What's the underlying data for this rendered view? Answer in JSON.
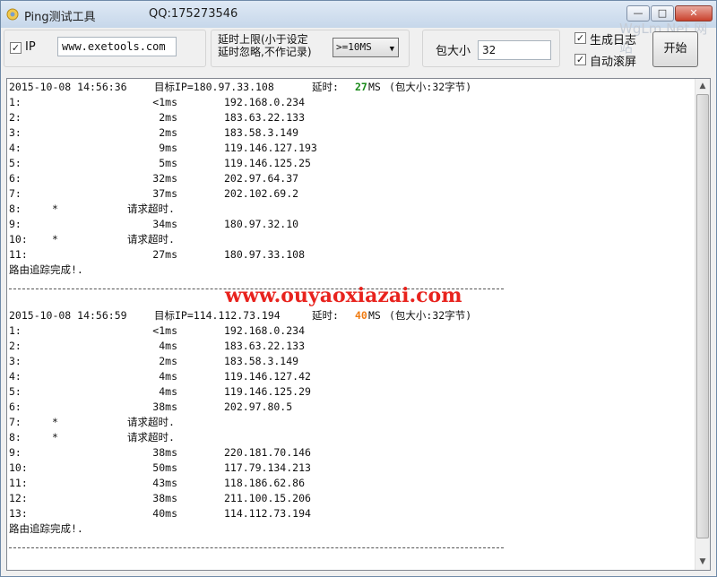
{
  "window": {
    "title": "Ping测试工具",
    "qq": "QQ:175273546",
    "watermark": "WgLm.Net 网站",
    "controls": {
      "minimize": "—",
      "maximize": "□",
      "close": "✕"
    },
    "icon": "ping-app-icon"
  },
  "toolbar": {
    "ip_checked": true,
    "ip_label": "IP",
    "host_value": "www.exetools.com",
    "delay_label_line1": "延时上限(小于设定",
    "delay_label_line2": "延时忽略,不作记录)",
    "delay_select": ">=10MS",
    "packet_label": "包大小",
    "packet_value": "32",
    "log_checked": true,
    "log_label": "生成日志",
    "scroll_checked": true,
    "scroll_label": "自动滚屏",
    "start_label": "开始"
  },
  "output": {
    "site_watermark": "www.ouyaoxiazai.com",
    "sessions": [
      {
        "header": {
          "datetime": "2015-10-08 14:56:36",
          "target": "目标IP=180.97.33.108",
          "delay_label": "延时:",
          "delay_value": "27",
          "delay_unit": "MS",
          "packet_info": "(包大小:32字节)"
        },
        "hops": [
          {
            "hop": "1:",
            "star": "",
            "latency": "<1ms",
            "ip": "192.168.0.234"
          },
          {
            "hop": "2:",
            "star": "",
            "latency": "2ms",
            "ip": "183.63.22.133"
          },
          {
            "hop": "3:",
            "star": "",
            "latency": "2ms",
            "ip": "183.58.3.149"
          },
          {
            "hop": "4:",
            "star": "",
            "latency": "9ms",
            "ip": "119.146.127.193"
          },
          {
            "hop": "5:",
            "star": "",
            "latency": "5ms",
            "ip": "119.146.125.25"
          },
          {
            "hop": "6:",
            "star": "",
            "latency": "32ms",
            "ip": "202.97.64.37"
          },
          {
            "hop": "7:",
            "star": "",
            "latency": "37ms",
            "ip": "202.102.69.2"
          },
          {
            "hop": "8:",
            "star": "*",
            "msg": "请求超时."
          },
          {
            "hop": "9:",
            "star": "",
            "latency": "34ms",
            "ip": "180.97.32.10"
          },
          {
            "hop": "10:",
            "star": "*",
            "msg": "请求超时."
          },
          {
            "hop": "11:",
            "star": "",
            "latency": "27ms",
            "ip": "180.97.33.108"
          }
        ],
        "complete": "路由追踪完成!."
      },
      {
        "header": {
          "datetime": "2015-10-08 14:56:59",
          "target": "目标IP=114.112.73.194",
          "delay_label": "延时:",
          "delay_value": "40",
          "delay_unit": "MS",
          "packet_info": "(包大小:32字节)"
        },
        "hops": [
          {
            "hop": "1:",
            "star": "",
            "latency": "<1ms",
            "ip": "192.168.0.234"
          },
          {
            "hop": "2:",
            "star": "",
            "latency": "4ms",
            "ip": "183.63.22.133"
          },
          {
            "hop": "3:",
            "star": "",
            "latency": "2ms",
            "ip": "183.58.3.149"
          },
          {
            "hop": "4:",
            "star": "",
            "latency": "4ms",
            "ip": "119.146.127.42"
          },
          {
            "hop": "5:",
            "star": "",
            "latency": "4ms",
            "ip": "119.146.125.29"
          },
          {
            "hop": "6:",
            "star": "",
            "latency": "38ms",
            "ip": "202.97.80.5"
          },
          {
            "hop": "7:",
            "star": "*",
            "msg": "请求超时."
          },
          {
            "hop": "8:",
            "star": "*",
            "msg": "请求超时."
          },
          {
            "hop": "9:",
            "star": "",
            "latency": "38ms",
            "ip": "220.181.70.146"
          },
          {
            "hop": "10:",
            "star": "",
            "latency": "50ms",
            "ip": "117.79.134.213"
          },
          {
            "hop": "11:",
            "star": "",
            "latency": "43ms",
            "ip": "118.186.62.86"
          },
          {
            "hop": "12:",
            "star": "",
            "latency": "38ms",
            "ip": "211.100.15.206"
          },
          {
            "hop": "13:",
            "star": "",
            "latency": "40ms",
            "ip": "114.112.73.194"
          }
        ],
        "complete": "路由追踪完成!."
      }
    ]
  },
  "colors": {
    "delay_green": "#1b8a1b",
    "delay_orange": "#f07c13",
    "watermark_red": "#e8231e"
  }
}
